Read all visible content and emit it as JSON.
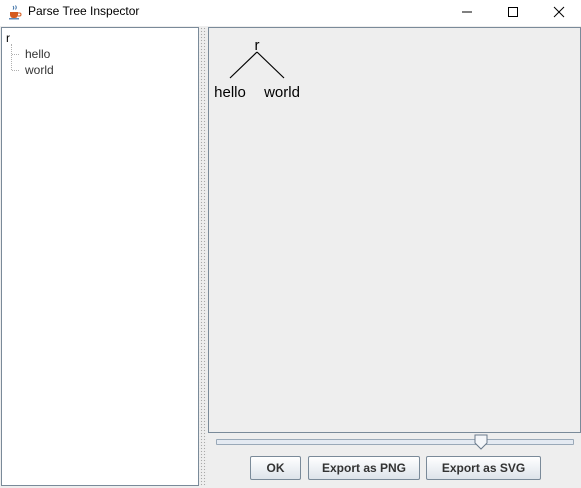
{
  "window": {
    "title": "Parse Tree Inspector",
    "icon": "java-cup-icon",
    "controls": [
      "minimize-icon",
      "maximize-icon",
      "close-icon"
    ]
  },
  "tree_outline": {
    "root": "r",
    "children": [
      "hello",
      "world"
    ]
  },
  "tree_view": {
    "root_label": "r",
    "leaves": [
      "hello",
      "world"
    ]
  },
  "zoom_slider": {
    "value_fraction": 0.75
  },
  "buttons": {
    "ok": "OK",
    "export_png": "Export as PNG",
    "export_svg": "Export as SVG"
  },
  "colors": {
    "pane_border": "#7a8a99",
    "canvas_background": "#eeeeee"
  }
}
